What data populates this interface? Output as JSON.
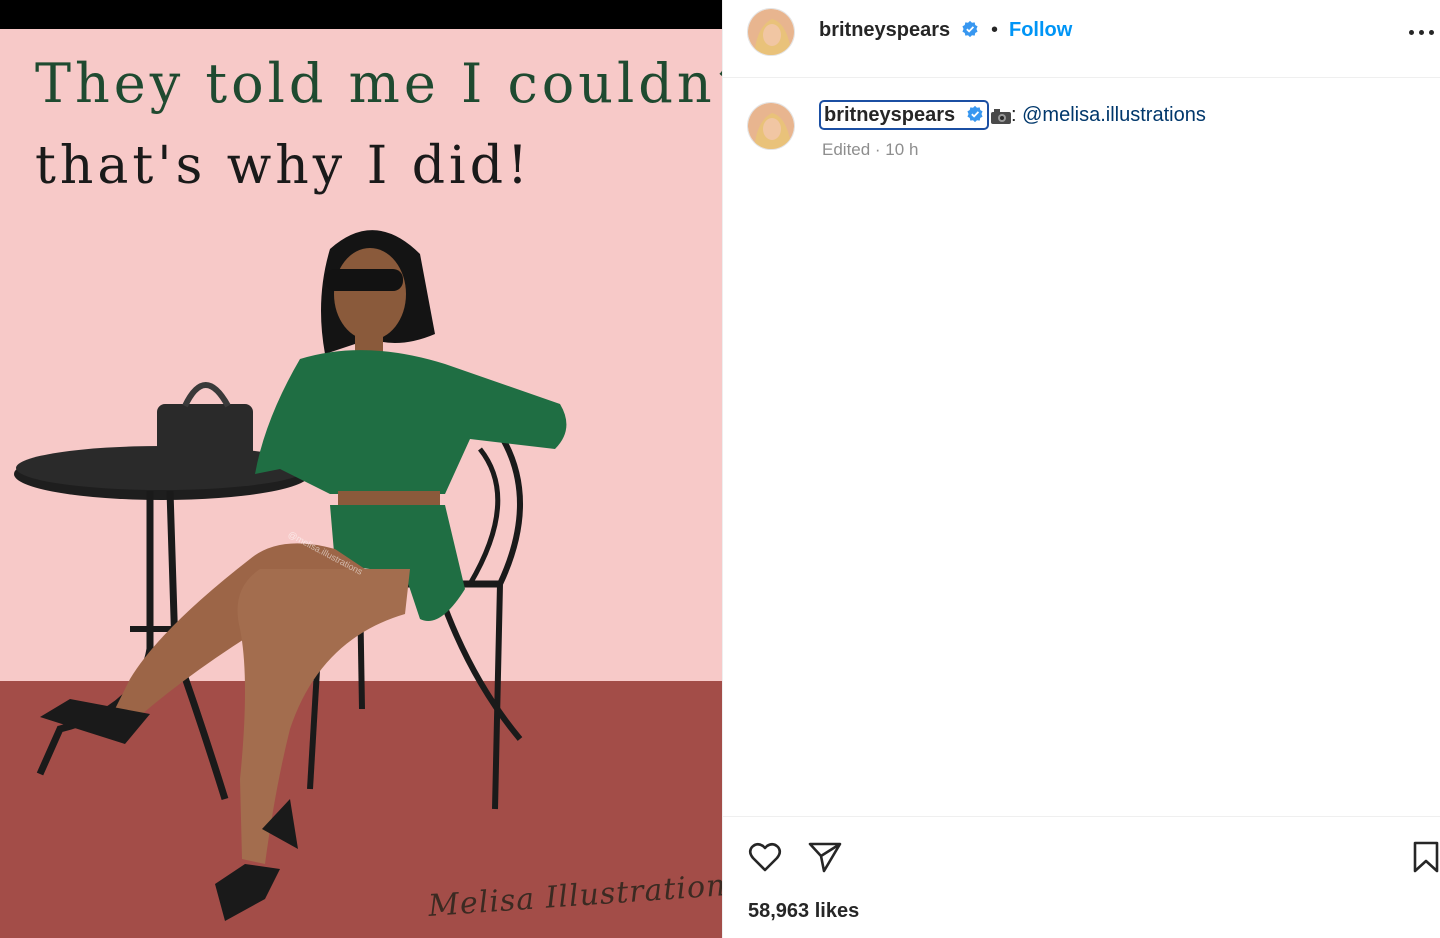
{
  "image": {
    "quote_line1": "They told me I couldn’t",
    "quote_line2": "that's why I did!",
    "signature": "Melisa Illustrations",
    "watermark": "@melisa.illustrations",
    "colors": {
      "wall": "#f7c9c8",
      "floor": "#a34d48",
      "outfit_green": "#1f6e43",
      "quote_green": "#1f4a30"
    }
  },
  "header": {
    "username": "britneyspears",
    "separator": "•",
    "follow_label": "Follow",
    "more_icon": "more-horizontal-icon"
  },
  "caption": {
    "username": "britneyspears",
    "camera_icon": "camera-icon",
    "text_prefix": ":",
    "mention": "@melisa.illustrations",
    "meta": "Edited · 10 h"
  },
  "actions": {
    "like_icon": "heart-icon",
    "share_icon": "paper-plane-icon",
    "save_icon": "bookmark-icon",
    "likes": "58,963 likes"
  },
  "colors": {
    "accent_blue": "#0095f6",
    "verified_blue": "#3897f0",
    "mention_blue": "#00376b",
    "meta_gray": "#8e8e8e"
  }
}
